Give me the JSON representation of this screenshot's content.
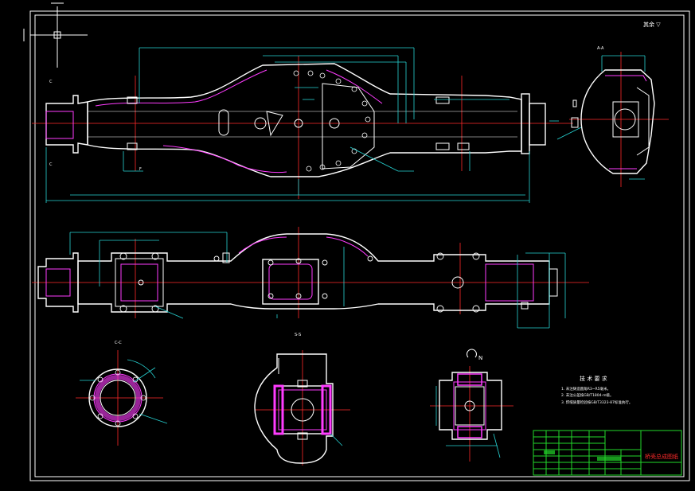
{
  "drawing": {
    "corner_note": "<reproduced as shape>",
    "section_labels": {
      "top_right": "A-A",
      "mid_left_flange": "C-C",
      "mid_center": "S-S",
      "mid_right_arrow": "N"
    },
    "tech_requirements": {
      "title": "技 术 要 求",
      "items": [
        "1. 未注铸造圆角R3~R5毫米。",
        "2. 未注公差按GB/T1804-m级。",
        "3. 焊缝质量检验按GB/T3323-87标准执行。"
      ]
    },
    "title_block": {
      "drawing_name": "桥壳总成图纸"
    }
  },
  "colors": {
    "background": "#000000",
    "outline": "#ffffff",
    "dimension": "#27d3d3",
    "centerline": "#ff2a2a",
    "hatch": "#ff3cff",
    "title_block": "#22d82a"
  }
}
